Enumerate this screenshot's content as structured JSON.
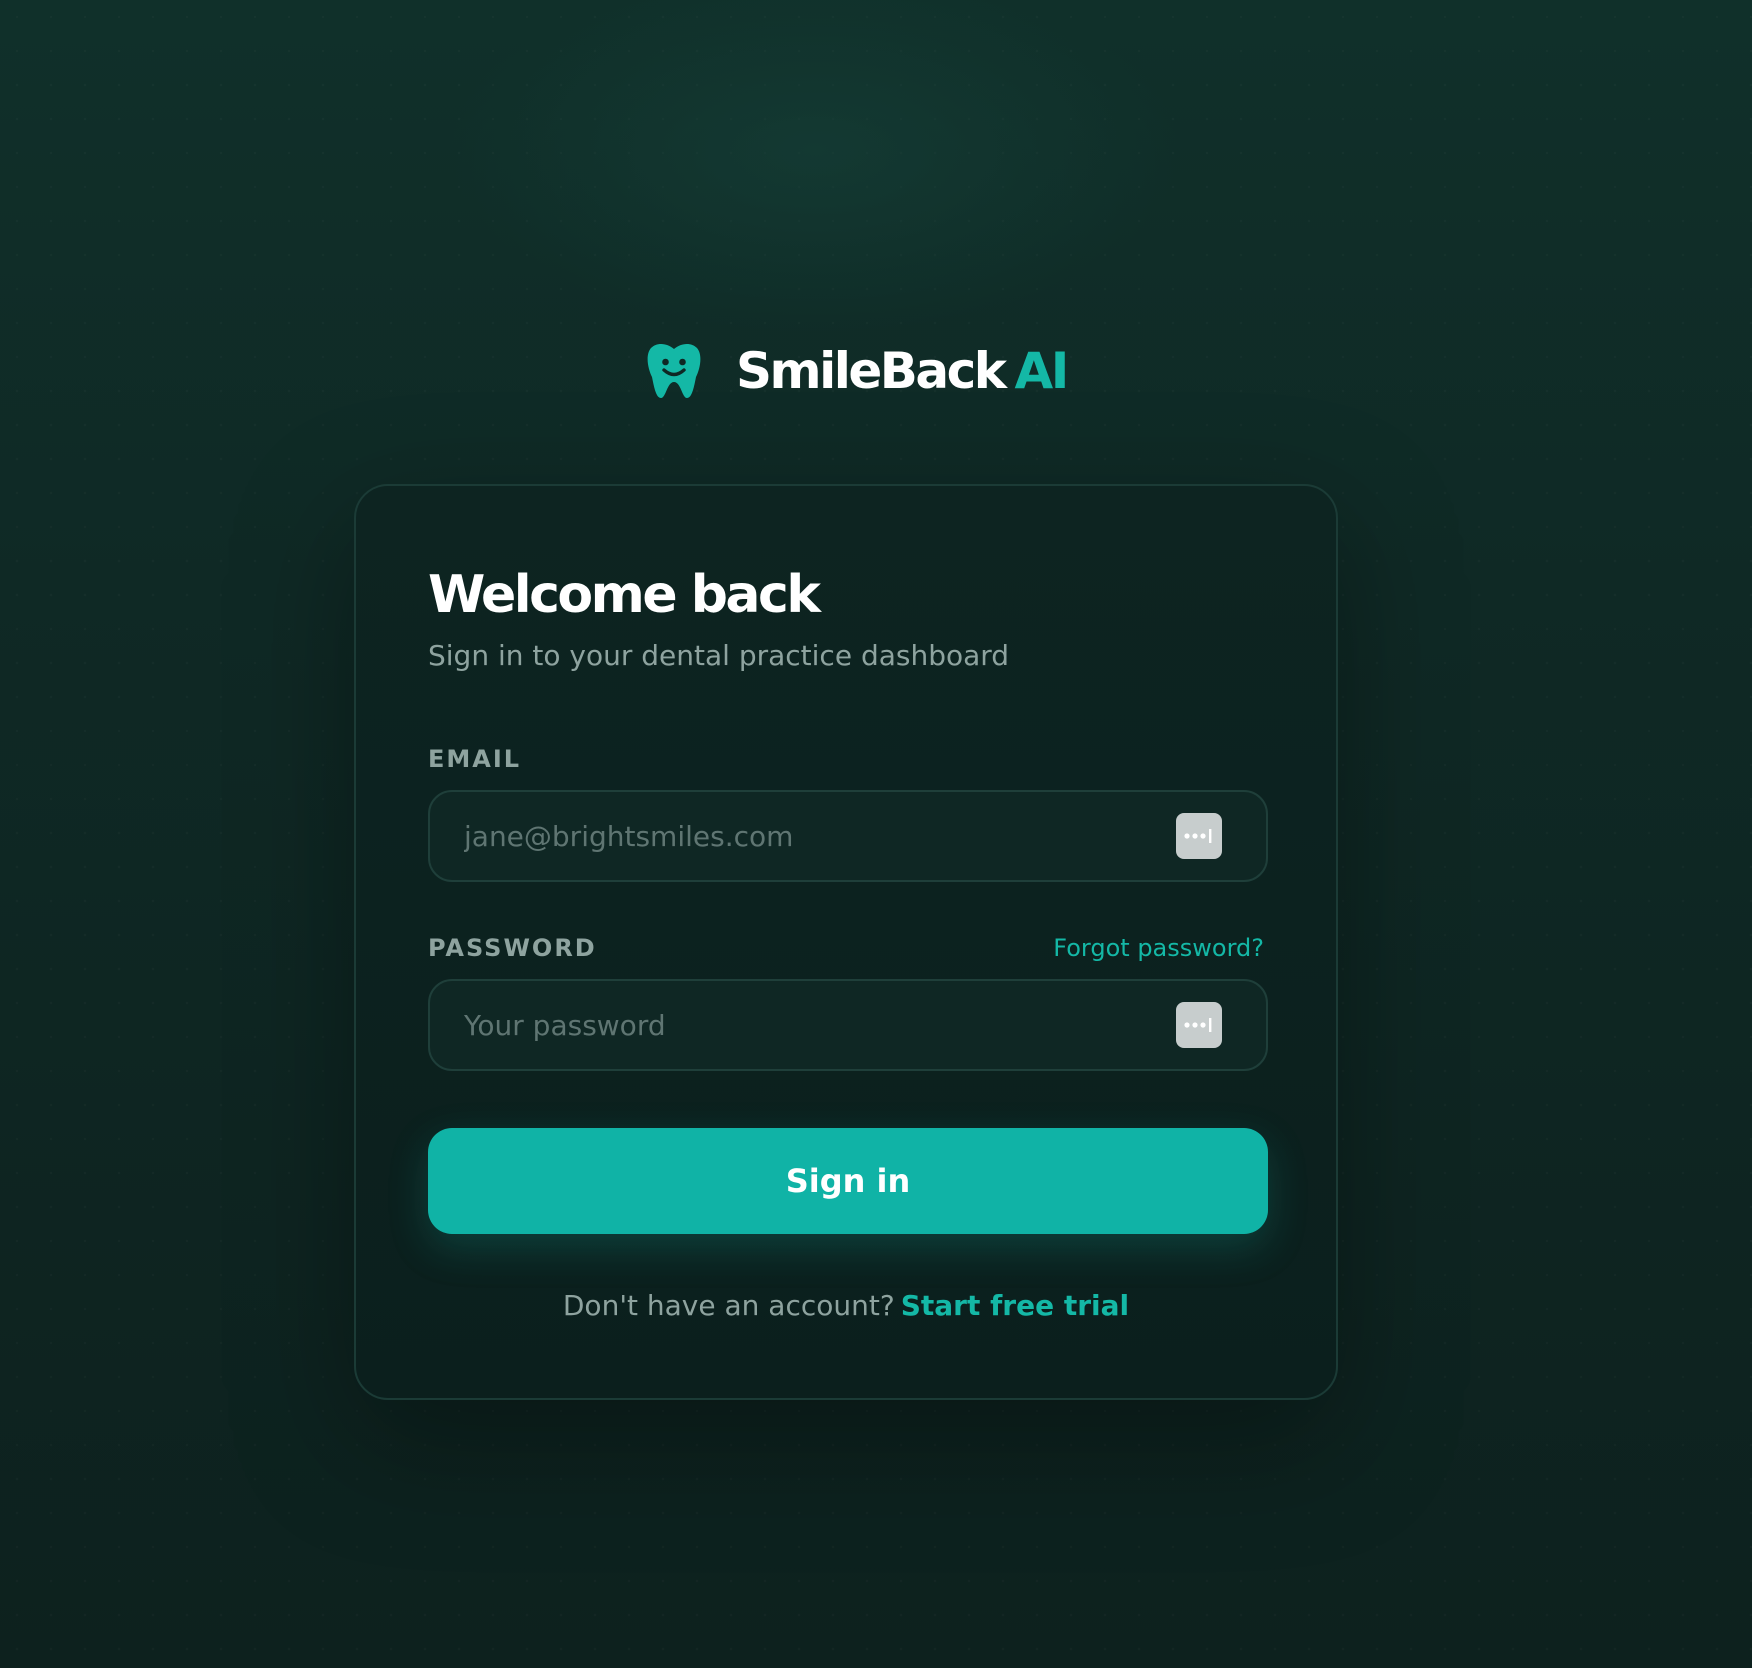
{
  "brand": {
    "name": "SmileBack",
    "accent": "AI",
    "logo_icon": "tooth-smile-icon",
    "accent_color": "#14b8a6"
  },
  "card": {
    "title": "Welcome back",
    "subtitle": "Sign in to your dental practice dashboard"
  },
  "email": {
    "label": "EMAIL",
    "placeholder": "jane@brightsmiles.com",
    "value": "",
    "autofill_icon": "password-manager-autofill-icon"
  },
  "password": {
    "label": "PASSWORD",
    "placeholder": "Your password",
    "value": "",
    "forgot_label": "Forgot password?",
    "autofill_icon": "password-manager-autofill-icon"
  },
  "actions": {
    "signin_label": "Sign in",
    "signin_color": "#10b3a6"
  },
  "footer": {
    "prompt": "Don't have an account?",
    "trial_label": "Start free trial"
  }
}
